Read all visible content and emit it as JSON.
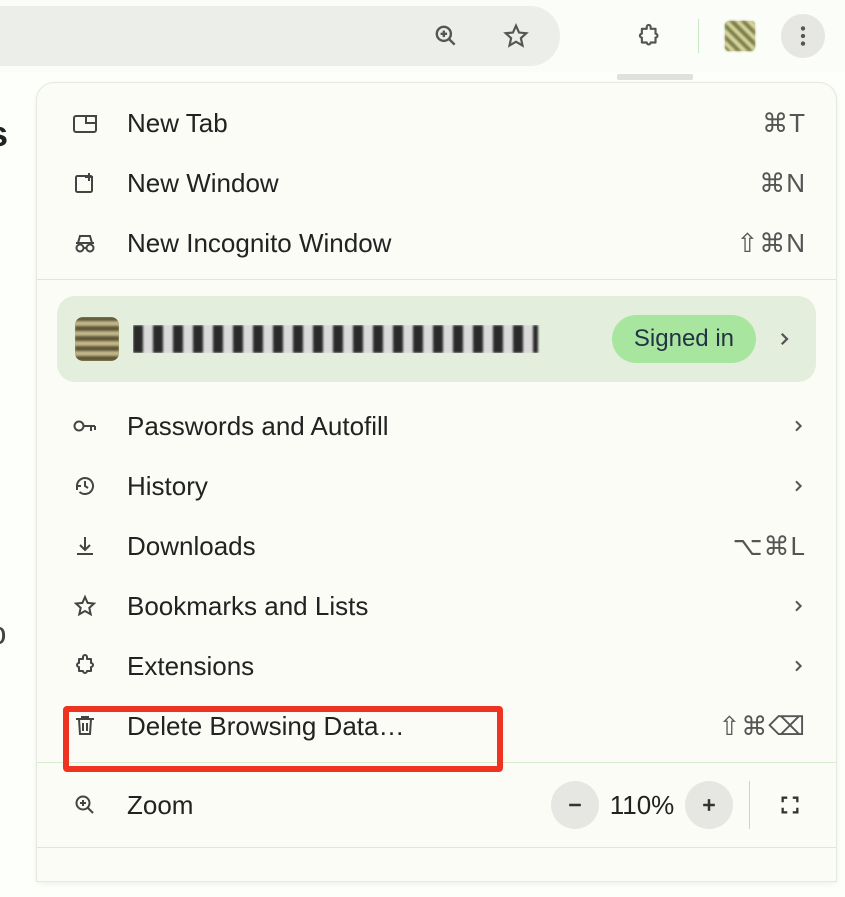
{
  "toolbar": {
    "zoom_icon": "zoom-in",
    "bookmark_icon": "star-outline",
    "extensions_icon": "puzzle",
    "menu_icon": "more-vert"
  },
  "menu": {
    "new_tab": {
      "label": "New Tab",
      "shortcut": "⌘T"
    },
    "new_window": {
      "label": "New Window",
      "shortcut": "⌘N"
    },
    "new_incognito": {
      "label": "New Incognito Window",
      "shortcut": "⇧⌘N"
    },
    "profile": {
      "signed_in": "Signed in"
    },
    "passwords": {
      "label": "Passwords and Autofill"
    },
    "history": {
      "label": "History"
    },
    "downloads": {
      "label": "Downloads",
      "shortcut": "⌥⌘L"
    },
    "bookmarks": {
      "label": "Bookmarks and Lists"
    },
    "extensions": {
      "label": "Extensions"
    },
    "delete_browsing": {
      "label": "Delete Browsing Data…",
      "shortcut": "⇧⌘⌫"
    },
    "zoom": {
      "label": "Zoom",
      "value": "110%"
    }
  }
}
